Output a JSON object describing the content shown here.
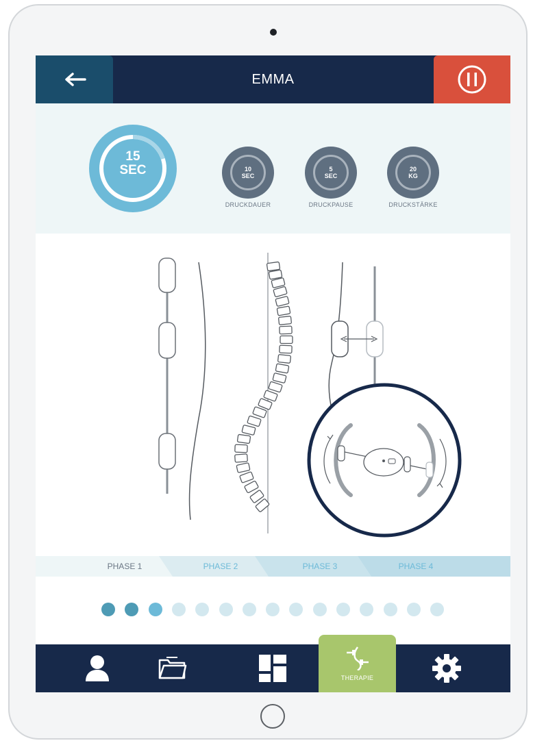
{
  "header": {
    "title": "EMMA",
    "back_icon": "arrow-left-icon",
    "pause_icon": "pause-icon"
  },
  "timer": {
    "value": "15",
    "unit": "SEC",
    "progress": 0.2
  },
  "settings": [
    {
      "value": "10",
      "unit": "SEC",
      "label": "DRUCKDAUER"
    },
    {
      "value": "5",
      "unit": "SEC",
      "label": "DRUCKPAUSE"
    },
    {
      "value": "20",
      "unit": "KG",
      "label": "DRUCKSTÄRKE"
    }
  ],
  "phases": [
    "PHASE 1",
    "PHASE 2",
    "PHASE 3",
    "PHASE 4"
  ],
  "active_phase": 0,
  "progress_dots": {
    "total": 15,
    "completed": 3
  },
  "nav": {
    "items": [
      "user-icon",
      "folder-icon",
      "dashboard-icon",
      "therapy-icon",
      "gear-icon"
    ],
    "active_label": "THERAPIE"
  },
  "colors": {
    "navy": "#17294a",
    "teal": "#1a4d6b",
    "red": "#d9503c",
    "blue": "#6dbad8",
    "green": "#a8c66c",
    "slate": "#5f6f80"
  }
}
